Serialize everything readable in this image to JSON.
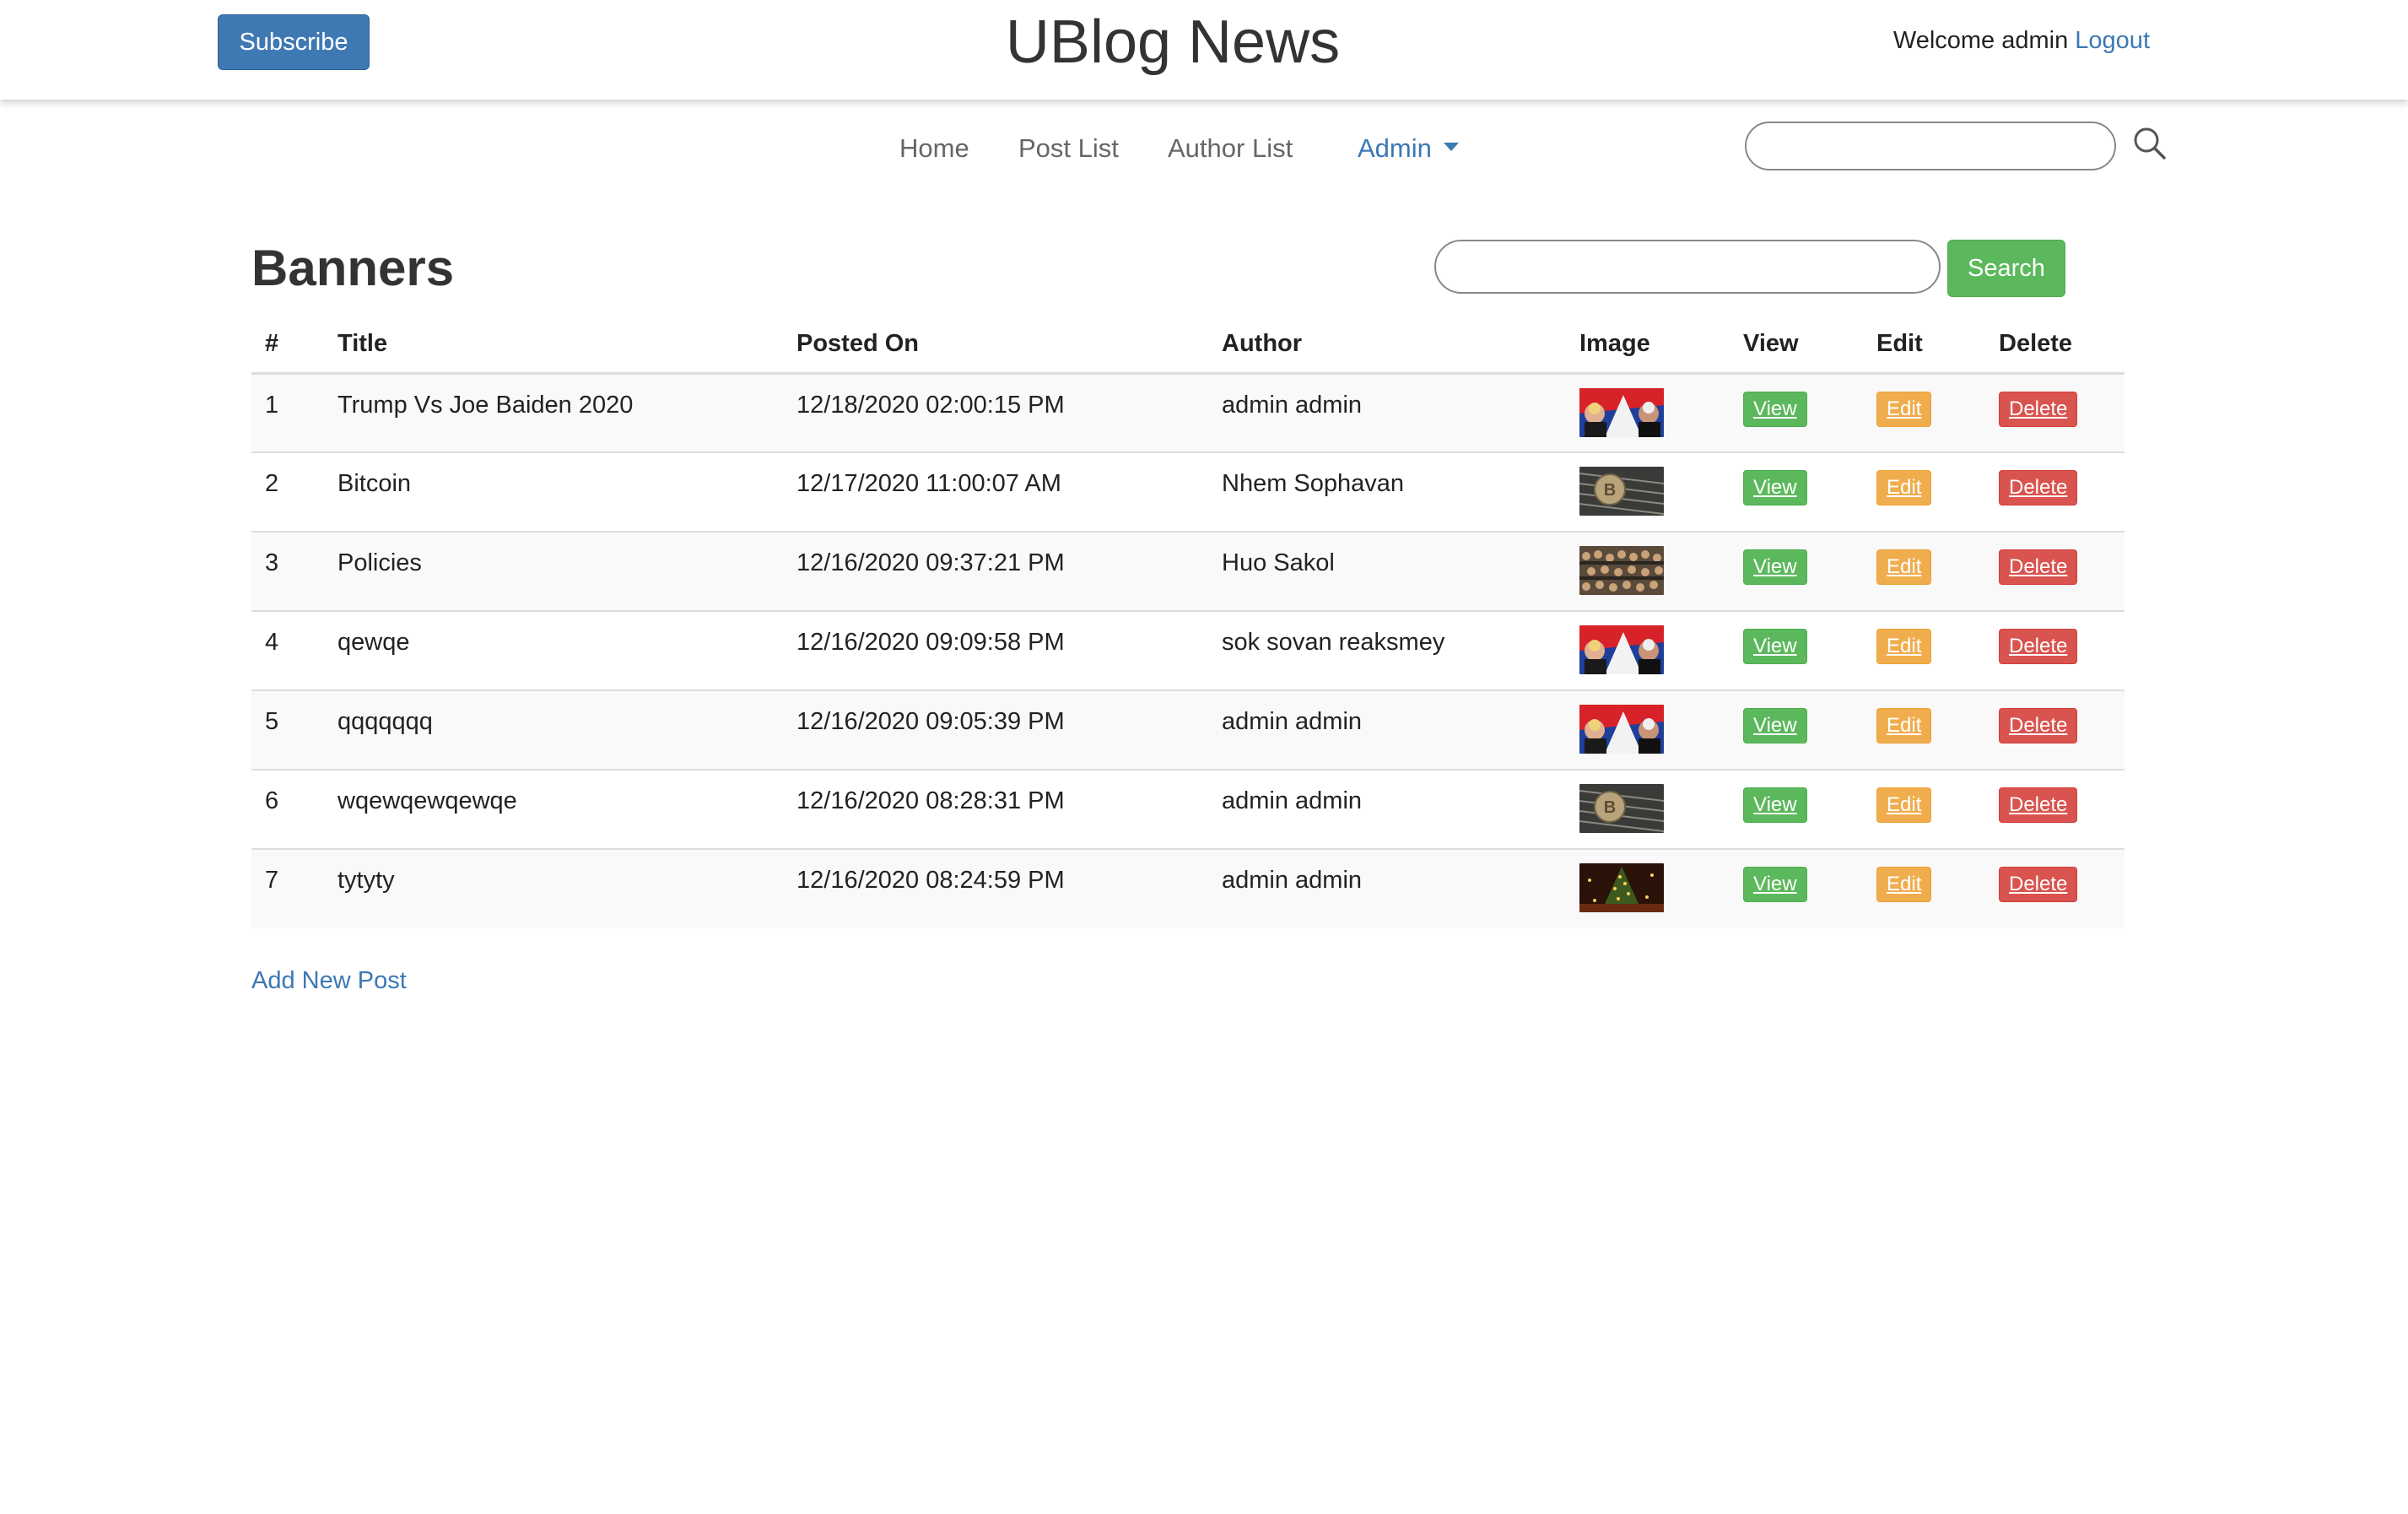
{
  "header": {
    "subscribe_label": "Subscribe",
    "site_title": "UBlog News",
    "welcome_text": "Welcome admin",
    "logout_label": "Logout"
  },
  "nav": {
    "items": [
      {
        "label": "Home"
      },
      {
        "label": "Post List"
      },
      {
        "label": "Author List"
      },
      {
        "label": "Admin"
      }
    ],
    "search_value": ""
  },
  "section": {
    "title": "Banners",
    "search_value": "",
    "search_button": "Search",
    "add_new_label": "Add New Post"
  },
  "table": {
    "headers": [
      "#",
      "Title",
      "Posted On",
      "Author",
      "Image",
      "View",
      "Edit",
      "Delete"
    ],
    "rows": [
      {
        "num": "1",
        "title": "Trump Vs Joe Baiden 2020",
        "posted_on": "12/18/2020 02:00:15 PM",
        "author": "admin admin",
        "image": "election-thumbnail",
        "view": "View",
        "edit": "Edit",
        "delete": "Delete"
      },
      {
        "num": "2",
        "title": "Bitcoin",
        "posted_on": "12/17/2020 11:00:07 AM",
        "author": "Nhem Sophavan",
        "image": "bitcoin-thumbnail",
        "view": "View",
        "edit": "Edit",
        "delete": "Delete"
      },
      {
        "num": "3",
        "title": "Policies",
        "posted_on": "12/16/2020 09:37:21 PM",
        "author": "Huo Sakol",
        "image": "crowd-thumbnail",
        "view": "View",
        "edit": "Edit",
        "delete": "Delete"
      },
      {
        "num": "4",
        "title": "qewqe",
        "posted_on": "12/16/2020 09:09:58 PM",
        "author": "sok sovan reaksmey",
        "image": "election-thumbnail",
        "view": "View",
        "edit": "Edit",
        "delete": "Delete"
      },
      {
        "num": "5",
        "title": "qqqqqqq",
        "posted_on": "12/16/2020 09:05:39 PM",
        "author": "admin admin",
        "image": "election-thumbnail",
        "view": "View",
        "edit": "Edit",
        "delete": "Delete"
      },
      {
        "num": "6",
        "title": "wqewqewqewqe",
        "posted_on": "12/16/2020 08:28:31 PM",
        "author": "admin admin",
        "image": "bitcoin-thumbnail",
        "view": "View",
        "edit": "Edit",
        "delete": "Delete"
      },
      {
        "num": "7",
        "title": "tytyty",
        "posted_on": "12/16/2020 08:24:59 PM",
        "author": "admin admin",
        "image": "christmas-tree-thumbnail",
        "view": "View",
        "edit": "Edit",
        "delete": "Delete"
      }
    ]
  },
  "colors": {
    "primary": "#3f79b4",
    "link": "#3c78b4",
    "success": "#5cb85c",
    "warning": "#f0ad4e",
    "danger": "#d9534f"
  }
}
